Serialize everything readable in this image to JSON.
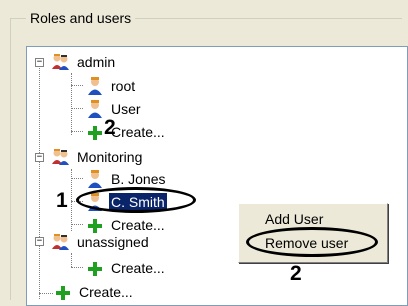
{
  "groupbox": {
    "title": "Roles and users"
  },
  "tree": {
    "admin": "admin",
    "root": "root",
    "user": "User",
    "create1": "Create...",
    "monitoring": "Monitoring",
    "bjones": "B. Jones",
    "csmith": "C. Smith",
    "create2": "Create...",
    "unassigned": "unassigned",
    "create3": "Create...",
    "create4": "Create..."
  },
  "context_menu": {
    "add_user": "Add User",
    "remove_user": "Remove user"
  },
  "annotations": {
    "n1": "1",
    "n2a": "2",
    "n2b": "2"
  },
  "colors": {
    "selection": "#0a246a",
    "tree_border": "#7f9db9",
    "window_bg": "#ece9d8"
  },
  "icons": {
    "group": "users-group-icon",
    "user": "user-icon",
    "create": "green-plus-icon"
  }
}
